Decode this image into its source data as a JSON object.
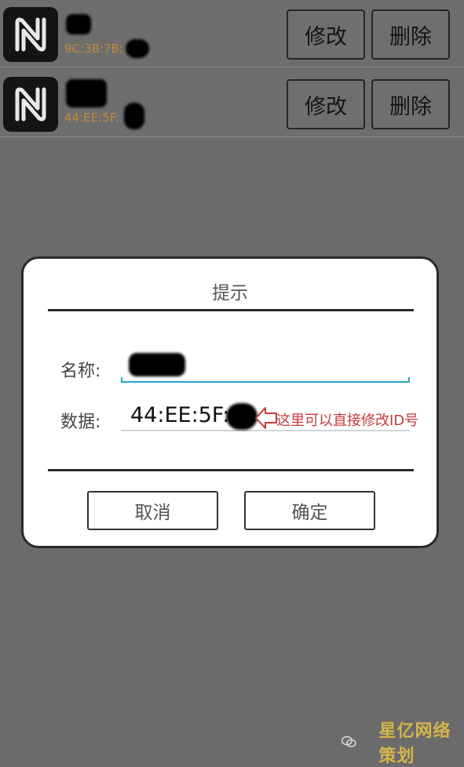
{
  "records": [
    {
      "id_text": "9C:3B:7B:",
      "edit_label": "修改",
      "delete_label": "删除"
    },
    {
      "id_text": "44:EE:5F:",
      "edit_label": "修改",
      "delete_label": "删除"
    }
  ],
  "dialog": {
    "title": "提示",
    "name_label": "名称:",
    "data_label": "数据:",
    "data_value": "44:EE:5F:",
    "annotation": "这里可以直接修改ID号",
    "cancel_label": "取消",
    "ok_label": "确定"
  },
  "watermark": {
    "text": "星亿网络策划"
  },
  "colors": {
    "background": "#6b6b6b",
    "id_text": "#c0883c",
    "input_focus": "#2aa3c3",
    "annotation": "#c43a3a",
    "watermark": "#d5b64a"
  },
  "icons": {
    "record": "nfc-icon",
    "annotation": "left-arrow-icon",
    "watermark": "wechat-icon"
  }
}
